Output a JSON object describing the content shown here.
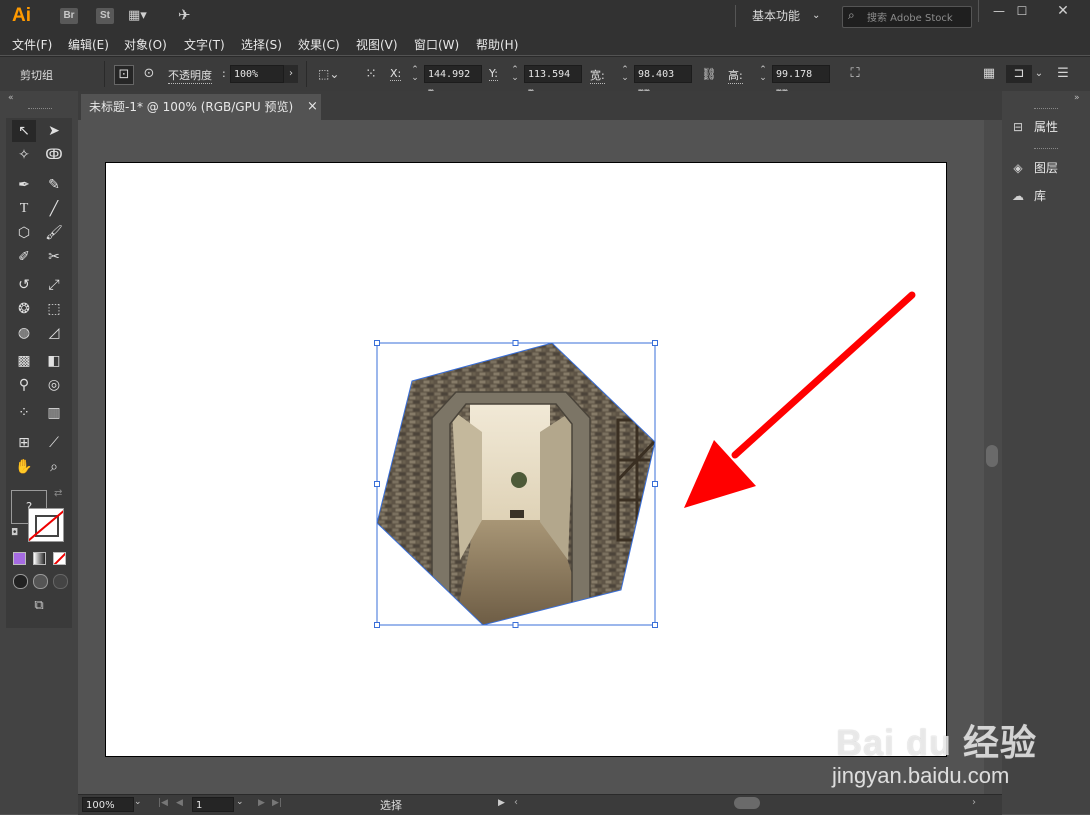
{
  "app": {
    "logo": "Ai",
    "bridge": "Br",
    "stock": "St"
  },
  "workspace": {
    "label": "基本功能"
  },
  "search": {
    "placeholder": "搜索 Adobe Stock"
  },
  "menu": [
    "文件(F)",
    "编辑(E)",
    "对象(O)",
    "文字(T)",
    "选择(S)",
    "效果(C)",
    "视图(V)",
    "窗口(W)",
    "帮助(H)"
  ],
  "control": {
    "selection_label": "剪切组",
    "opacity_label": "不透明度",
    "opacity_value": "100%",
    "x_label": "X:",
    "x_value": "144.992 m",
    "y_label": "Y:",
    "y_value": "113.594 m",
    "w_label": "宽:",
    "w_value": "98.403 mm",
    "h_label": "高:",
    "h_value": "99.178 mm"
  },
  "document": {
    "tab_title": "未标题-1* @ 100% (RGB/GPU 预览)",
    "close": "×"
  },
  "right_panel": {
    "properties": "属性",
    "layers": "图层",
    "libraries": "库"
  },
  "status": {
    "zoom": "100%",
    "page": "1",
    "tool": "选择"
  },
  "watermark": {
    "logo": "Bai du 经验",
    "url": "jingyan.baidu.com"
  },
  "colors": {
    "accent": "#ff9a00",
    "selection": "#3a6fd8",
    "arrow": "#ff0000"
  }
}
